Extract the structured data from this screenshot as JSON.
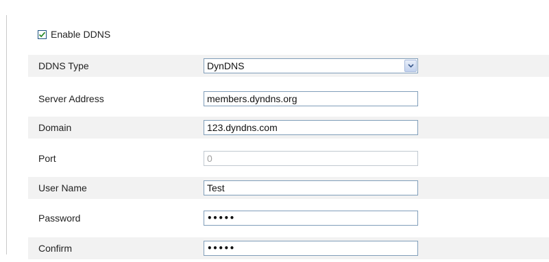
{
  "ddns": {
    "enable_label": "Enable DDNS",
    "enabled": true,
    "fields": {
      "ddns_type": {
        "label": "DDNS Type",
        "value": "DynDNS"
      },
      "server_address": {
        "label": "Server Address",
        "value": "members.dyndns.org"
      },
      "domain": {
        "label": "Domain",
        "value": "123.dyndns.com"
      },
      "port": {
        "label": "Port",
        "value": "0"
      },
      "user_name": {
        "label": "User Name",
        "value": "Test"
      },
      "password": {
        "label": "Password",
        "value": "•••••"
      },
      "confirm": {
        "label": "Confirm",
        "value": "•••••"
      }
    }
  },
  "icons": {
    "checkbox": "checkmark-icon",
    "dropdown": "chevron-down-icon"
  },
  "colors": {
    "row_shade": "#f2f2f2",
    "input_border": "#7f9db9",
    "checkbox_mark": "#2a8a2a",
    "disabled_text": "#a0a0a0"
  }
}
